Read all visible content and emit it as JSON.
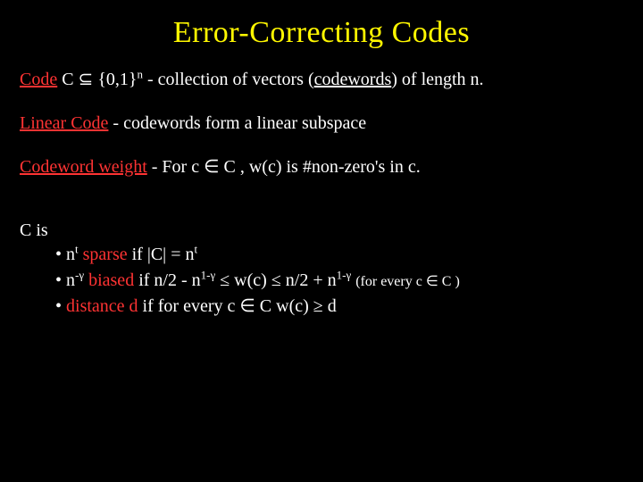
{
  "title": "Error-Correcting Codes",
  "line1": {
    "term": "Code",
    "math": "C ⊆ {0,1}",
    "sup": "n",
    "rest1": " - collection of vectors (",
    "codewords": "codewords",
    "rest2": ") of length n."
  },
  "line2": {
    "term": "Linear Code",
    "rest": " -  codewords form a linear subspace"
  },
  "line3": {
    "term": "Codeword weight",
    "rest1": " - For c ∈ C , w(c) is #non-zero's in c."
  },
  "block": {
    "head": "C is",
    "b1": {
      "pre": "n",
      "sup1": "t",
      "mid": " sparse",
      "rest": " if |C| = n",
      "sup2": "t"
    },
    "b2": {
      "pre": "n",
      "sup1": "-γ",
      "mid": " biased",
      "rest1": " if n/2 - n",
      "sup2": "1-γ",
      "rest2": " ≤   w(c)  ≤ n/2 + n",
      "sup3": "1-γ",
      "tail": " (for every c ∈ C )"
    },
    "b3": {
      "mid": "distance   d ",
      "rest": " if for every c ∈ C w(c) ≥ d"
    }
  }
}
